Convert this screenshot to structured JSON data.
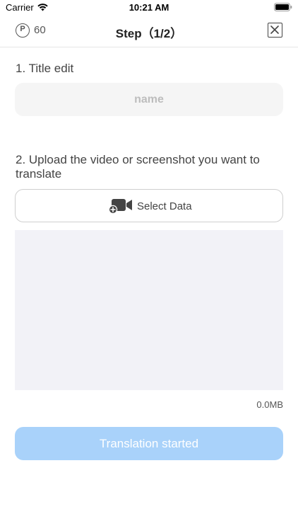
{
  "status_bar": {
    "carrier": "Carrier",
    "time": "10:21 AM"
  },
  "nav": {
    "points_symbol": "P",
    "points_value": "60",
    "title": "Step（1/2）",
    "close_icon": "close-box-icon"
  },
  "step1": {
    "label": "1. Title edit",
    "input_value": "",
    "input_placeholder": "name"
  },
  "step2": {
    "label": "2. Upload the video or screenshot you want to translate",
    "select_button_label": "Select Data",
    "select_icon": "video-add-icon",
    "file_size": "0.0MB"
  },
  "action": {
    "start_button_label": "Translation started"
  },
  "colors": {
    "start_button_bg": "#a9d2fa",
    "preview_bg": "#f2f2f7",
    "input_bg": "#f5f5f5"
  }
}
